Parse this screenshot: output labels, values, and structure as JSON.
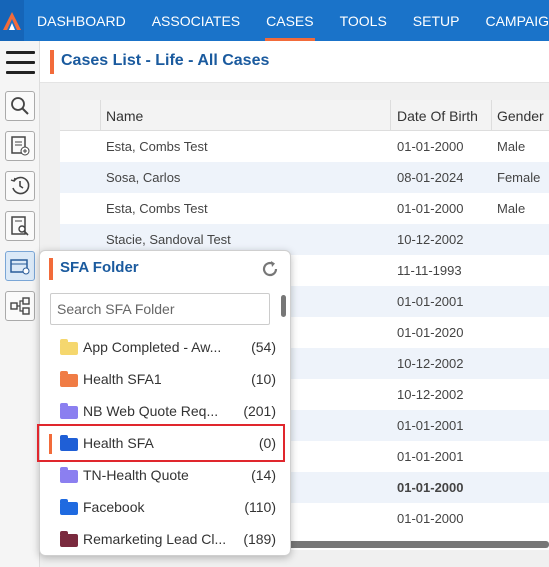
{
  "nav": {
    "items": [
      "DASHBOARD",
      "ASSOCIATES",
      "CASES",
      "TOOLS",
      "SETUP",
      "CAMPAIGN"
    ],
    "active": "CASES"
  },
  "page": {
    "title": "Cases List - Life - All Cases"
  },
  "grid": {
    "columns": [
      "Name",
      "Date Of Birth",
      "Gender"
    ],
    "rows": [
      {
        "name": "Esta, Combs Test",
        "dob": "01-01-2000",
        "gender": "Male"
      },
      {
        "name": "Sosa, Carlos",
        "dob": "08-01-2024",
        "gender": "Female"
      },
      {
        "name": "Esta, Combs Test",
        "dob": "01-01-2000",
        "gender": "Male"
      },
      {
        "name": "Stacie, Sandoval Test",
        "dob": "10-12-2002",
        "gender": ""
      },
      {
        "name": "",
        "dob": "11-11-1993",
        "gender": ""
      },
      {
        "name": "",
        "dob": "01-01-2001",
        "gender": ""
      },
      {
        "name": "",
        "dob": "01-01-2020",
        "gender": ""
      },
      {
        "name": "",
        "dob": "10-12-2002",
        "gender": ""
      },
      {
        "name": "",
        "dob": "10-12-2002",
        "gender": ""
      },
      {
        "name": "",
        "dob": "01-01-2001",
        "gender": ""
      },
      {
        "name": "",
        "dob": "01-01-2001",
        "gender": ""
      },
      {
        "name": "",
        "dob": "01-01-2000",
        "gender": ""
      },
      {
        "name": "",
        "dob": "01-01-2000",
        "gender": ""
      }
    ]
  },
  "sfa": {
    "title": "SFA Folder",
    "search_placeholder": "Search SFA Folder",
    "folders": [
      {
        "name": "App Completed - Aw...",
        "count": "(54)",
        "color": "#f5d76e"
      },
      {
        "name": "Health SFA1",
        "count": "(10)",
        "color": "#f07c45"
      },
      {
        "name": "NB Web Quote Req...",
        "count": "(201)",
        "color": "#8b7ff0"
      },
      {
        "name": "Health SFA",
        "count": "(0)",
        "color": "#1f5fd6",
        "selected": true
      },
      {
        "name": "TN-Health Quote",
        "count": "(14)",
        "color": "#8b7ff0"
      },
      {
        "name": "Facebook",
        "count": "(110)",
        "color": "#1f6ae0"
      },
      {
        "name": "Remarketing Lead Cl...",
        "count": "(189)",
        "color": "#7a2a3e"
      }
    ]
  },
  "icons": [
    "logo-icon",
    "menu-icon",
    "search-cases-icon",
    "add-case-icon",
    "history-icon",
    "report-search-icon",
    "sfa-folder-icon",
    "workflow-icon",
    "refresh-icon",
    "folder-icon"
  ]
}
